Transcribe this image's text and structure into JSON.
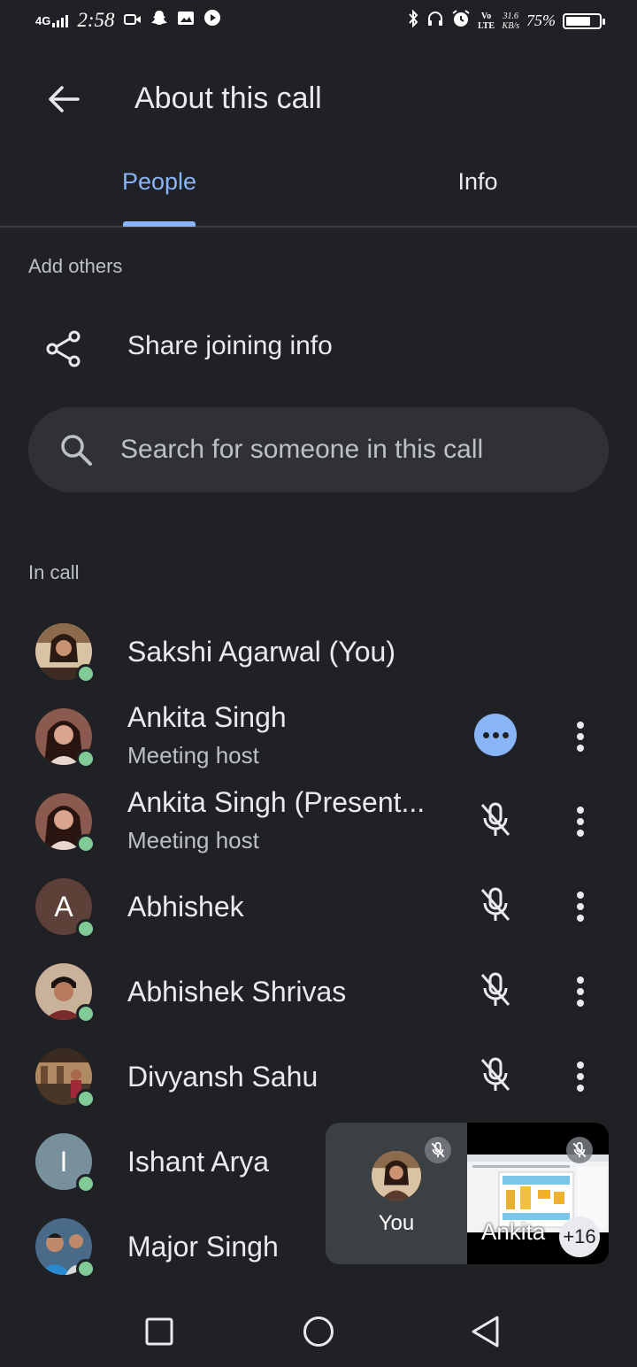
{
  "status_bar": {
    "network": "4G",
    "time": "2:58",
    "volte": "Vo LTE",
    "speed_value": "31.6",
    "speed_unit": "KB/s",
    "battery_percent": "75%",
    "battery_level": 0.75
  },
  "header": {
    "title": "About this call"
  },
  "tabs": [
    {
      "label": "People",
      "active": true
    },
    {
      "label": "Info",
      "active": false
    }
  ],
  "add_others": {
    "heading": "Add others",
    "share_label": "Share joining info"
  },
  "search": {
    "placeholder": "Search for someone in this call",
    "value": ""
  },
  "in_call": {
    "heading": "In call",
    "participants": [
      {
        "name": "Sakshi Agarwal (You)",
        "subtitle": "",
        "avatar": "photo",
        "mic": "none"
      },
      {
        "name": "Ankita Singh",
        "subtitle": "Meeting host",
        "avatar": "photo",
        "mic": "speaking"
      },
      {
        "name": "Ankita Singh (Present...",
        "subtitle": "Meeting host",
        "avatar": "photo",
        "mic": "muted"
      },
      {
        "name": "Abhishek",
        "subtitle": "",
        "avatar": "A",
        "avatar_color": "#5d4037",
        "mic": "muted"
      },
      {
        "name": "Abhishek Shrivas",
        "subtitle": "",
        "avatar": "photo",
        "mic": "muted"
      },
      {
        "name": "Divyansh Sahu",
        "subtitle": "",
        "avatar": "photo",
        "mic": "muted"
      },
      {
        "name": "Ishant Arya",
        "subtitle": "",
        "avatar": "I",
        "avatar_color": "#78909c",
        "mic": "hidden"
      },
      {
        "name": "Major Singh",
        "subtitle": "",
        "avatar": "photo",
        "mic": "hidden"
      }
    ]
  },
  "pip": {
    "self_label": "You",
    "other_label": "Ankita",
    "more_count": "+16"
  },
  "colors": {
    "background": "#202124",
    "accent": "#8ab4f8",
    "online": "#81c995"
  }
}
